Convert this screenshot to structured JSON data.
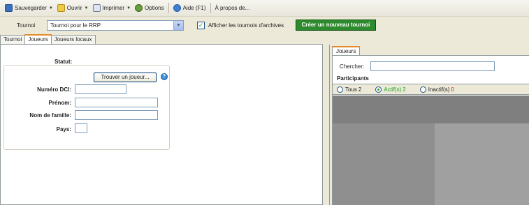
{
  "toolbar": {
    "save": "Sauvegarder",
    "open": "Ouvrir",
    "print": "Imprimer",
    "options": "Options",
    "help": "Aide (F1)",
    "about": "À propos de..."
  },
  "tournament": {
    "label": "Tournoi",
    "selected": "Tournoi pour le RRP",
    "archive_checkbox_label": "Afficher les tournois d'archives",
    "archive_checked": true,
    "new_button": "Créer un nouveau tournoi"
  },
  "tabs": [
    {
      "label": "Tournoi",
      "active": false
    },
    {
      "label": "Joueurs",
      "active": true
    },
    {
      "label": "Joueurs locaux",
      "active": false
    }
  ],
  "player_form": {
    "status_label": "Statut:",
    "find_button": "Trouver un joueur...",
    "help_glyph": "?",
    "fields": {
      "dci_label": "Numéro DCI:",
      "firstname_label": "Prénom:",
      "lastname_label": "Nom de famille:",
      "country_label": "Pays:"
    }
  },
  "players_panel": {
    "tab": "Joueurs",
    "search_label": "Chercher:",
    "search_value": "",
    "participants_label": "Participants",
    "filters": [
      {
        "label": "Tous",
        "count": "2",
        "selected": false,
        "color": "#222222"
      },
      {
        "label": "Actif(s)",
        "count": "2",
        "selected": true,
        "color": "#21a121"
      },
      {
        "label": "Inactif(s)",
        "count": "0",
        "selected": false,
        "color": "#dd1111"
      }
    ]
  },
  "colors": {
    "accent_green": "#2d8a2d",
    "tab_highlight": "#e68b2c"
  }
}
